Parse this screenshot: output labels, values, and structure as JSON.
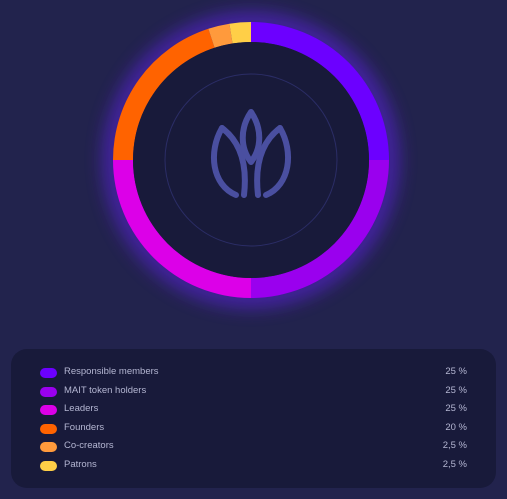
{
  "chart_data": {
    "type": "pie",
    "variant": "donut",
    "series": [
      {
        "label": "Responsible members",
        "value": 25,
        "display": "25 %",
        "color": "#6c00ff"
      },
      {
        "label": "MAIT token holders",
        "value": 25,
        "display": "25 %",
        "color": "#9a00ee"
      },
      {
        "label": "Leaders",
        "value": 25,
        "display": "25 %",
        "color": "#dc00e8"
      },
      {
        "label": "Founders",
        "value": 20,
        "display": "20 %",
        "color": "#ff6300"
      },
      {
        "label": "Co-creators",
        "value": 2.5,
        "display": "2,5 %",
        "color": "#ff9a3c"
      },
      {
        "label": "Patrons",
        "value": 2.5,
        "display": "2,5 %",
        "color": "#ffcf47"
      }
    ],
    "start": "top",
    "direction": "clockwise",
    "legend": "bottom",
    "center_icon": "tulip-logo-icon"
  },
  "colors": {
    "background": "#22234d",
    "panel": "#181a3a",
    "donut_center": "#181a3a",
    "logo": "#4a4fa0"
  }
}
